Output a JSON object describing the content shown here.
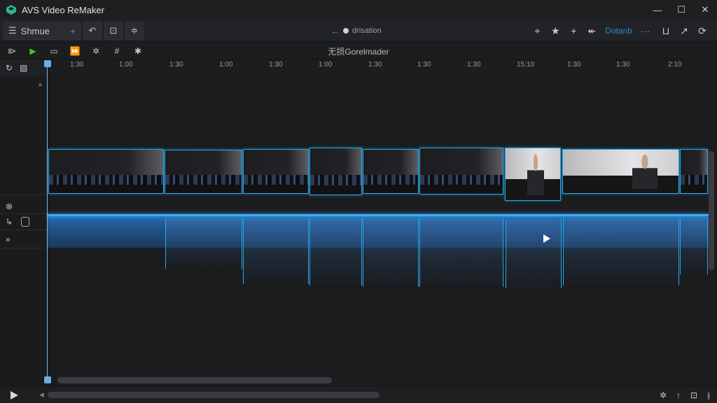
{
  "window": {
    "title": "AVS Video ReMaker",
    "controls": [
      "—",
      "☐",
      "✕"
    ]
  },
  "toolbar": {
    "menu_label": "Shmue",
    "add_icon": "+",
    "center_text": "drisation",
    "accent_label": "Dotanb",
    "more_label": "···"
  },
  "transport": {
    "title": "无损Gorelmader"
  },
  "ruler": {
    "ticks": [
      "1:30",
      "1.00",
      "1:30",
      "1:00",
      "1:30",
      "1:00",
      "1:30",
      "1:30",
      "1:30",
      "15:10",
      "1:30",
      "1:30",
      "2:10"
    ]
  },
  "left_panel": {
    "row1_label": "⊗",
    "row2_label": "↳",
    "row3_label": "»"
  },
  "colors": {
    "accent": "#1f8fd6",
    "clip_border": "#2aa6e6",
    "play_green": "#52c41a"
  },
  "icons": [
    "app-logo-icon",
    "hamburger-icon",
    "plus-icon",
    "undo-icon",
    "crop-icon",
    "sliders-icon",
    "pin-icon",
    "star-icon",
    "cross-icon",
    "arrow-left-icon",
    "expand-icon",
    "export-icon",
    "settings-icon"
  ]
}
